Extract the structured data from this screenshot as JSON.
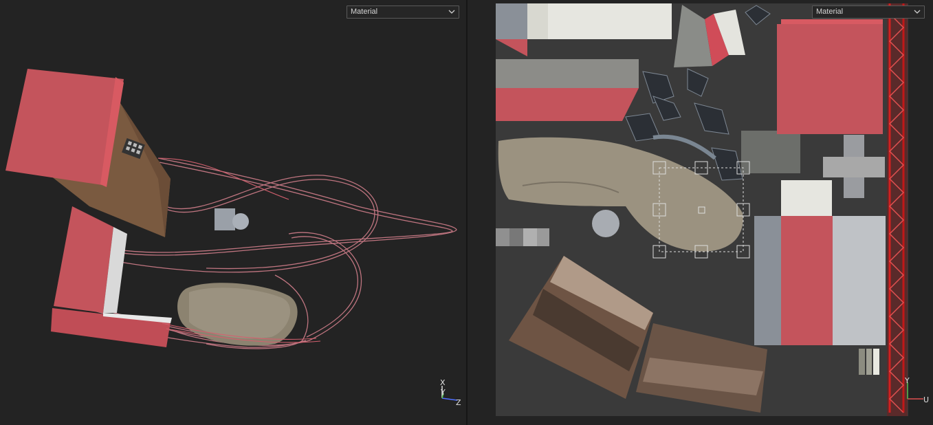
{
  "left_viewport": {
    "shading_mode": "Material",
    "gizmo": {
      "x": "X",
      "y": "Y",
      "z": "Z"
    }
  },
  "right_viewport": {
    "shading_mode": "Material",
    "gizmo": {
      "u": "U",
      "v": "Y"
    }
  },
  "colors": {
    "background": "#232323",
    "uv_canvas": "#3a3a3a",
    "pink_material": "#c4545c",
    "rail_red": "#b02020"
  }
}
